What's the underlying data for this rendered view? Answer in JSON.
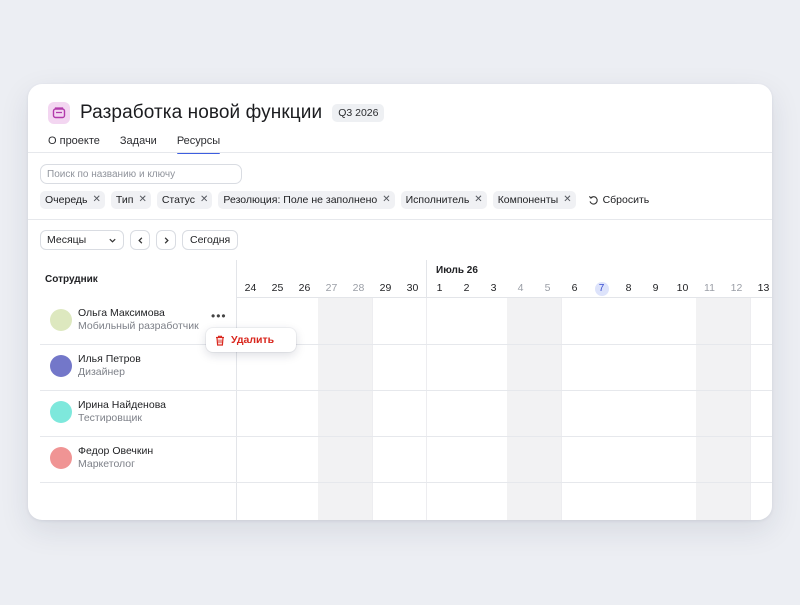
{
  "header": {
    "title": "Разработка новой функции",
    "period": "Q3 2026"
  },
  "tabs": [
    {
      "label": "О проекте",
      "active": false
    },
    {
      "label": "Задачи",
      "active": false
    },
    {
      "label": "Ресурсы",
      "active": true
    }
  ],
  "search": {
    "placeholder": "Поиск по названию и ключу",
    "value": ""
  },
  "filters": [
    {
      "label": "Очередь"
    },
    {
      "label": "Тип"
    },
    {
      "label": "Статус"
    },
    {
      "label": "Резолюция: Поле не заполнено"
    },
    {
      "label": "Исполнитель"
    },
    {
      "label": "Компоненты"
    }
  ],
  "reset_label": "Сбросить",
  "controls": {
    "scale": "Месяцы",
    "today_label": "Сегодня"
  },
  "grid": {
    "employee_header": "Сотрудник",
    "month_label": "Июль 26",
    "days": [
      {
        "label": "24",
        "weekend": false,
        "today": false
      },
      {
        "label": "25",
        "weekend": false,
        "today": false
      },
      {
        "label": "26",
        "weekend": false,
        "today": false
      },
      {
        "label": "27",
        "weekend": true,
        "today": false
      },
      {
        "label": "28",
        "weekend": true,
        "today": false
      },
      {
        "label": "29",
        "weekend": false,
        "today": false
      },
      {
        "label": "30",
        "weekend": false,
        "today": false
      },
      {
        "label": "1",
        "weekend": false,
        "today": false
      },
      {
        "label": "2",
        "weekend": false,
        "today": false
      },
      {
        "label": "3",
        "weekend": false,
        "today": false
      },
      {
        "label": "4",
        "weekend": true,
        "today": false
      },
      {
        "label": "5",
        "weekend": true,
        "today": false
      },
      {
        "label": "6",
        "weekend": false,
        "today": false
      },
      {
        "label": "7",
        "weekend": false,
        "today": true
      },
      {
        "label": "8",
        "weekend": false,
        "today": false
      },
      {
        "label": "9",
        "weekend": false,
        "today": false
      },
      {
        "label": "10",
        "weekend": false,
        "today": false
      },
      {
        "label": "11",
        "weekend": true,
        "today": false
      },
      {
        "label": "12",
        "weekend": true,
        "today": false
      },
      {
        "label": "13",
        "weekend": false,
        "today": false
      }
    ],
    "employees": [
      {
        "name": "Ольга Максимова",
        "role": "Мобильный разработчик",
        "color": "#dde8bf"
      },
      {
        "name": "Илья Петров",
        "role": "Дизайнер",
        "color": "#7377c9"
      },
      {
        "name": "Ирина Найденова",
        "role": "Тестировщик",
        "color": "#7ee8dc"
      },
      {
        "name": "Федор Овечкин",
        "role": "Маркетолог",
        "color": "#f09494"
      }
    ]
  },
  "context_menu": {
    "delete_label": "Удалить"
  },
  "colors": {
    "accent": "#3d5ee0",
    "danger": "#d9271e",
    "weekend_bg": "#f2f2f3",
    "today_bg": "#dde3fb"
  },
  "icons": {
    "project": "folder-icon",
    "chip_remove": "close-icon",
    "reset": "rotate-ccw-icon",
    "select": "chevron-down-icon",
    "prev": "chevron-left-icon",
    "next": "chevron-right-icon",
    "more": "more-horizontal-icon",
    "delete": "trash-icon"
  }
}
